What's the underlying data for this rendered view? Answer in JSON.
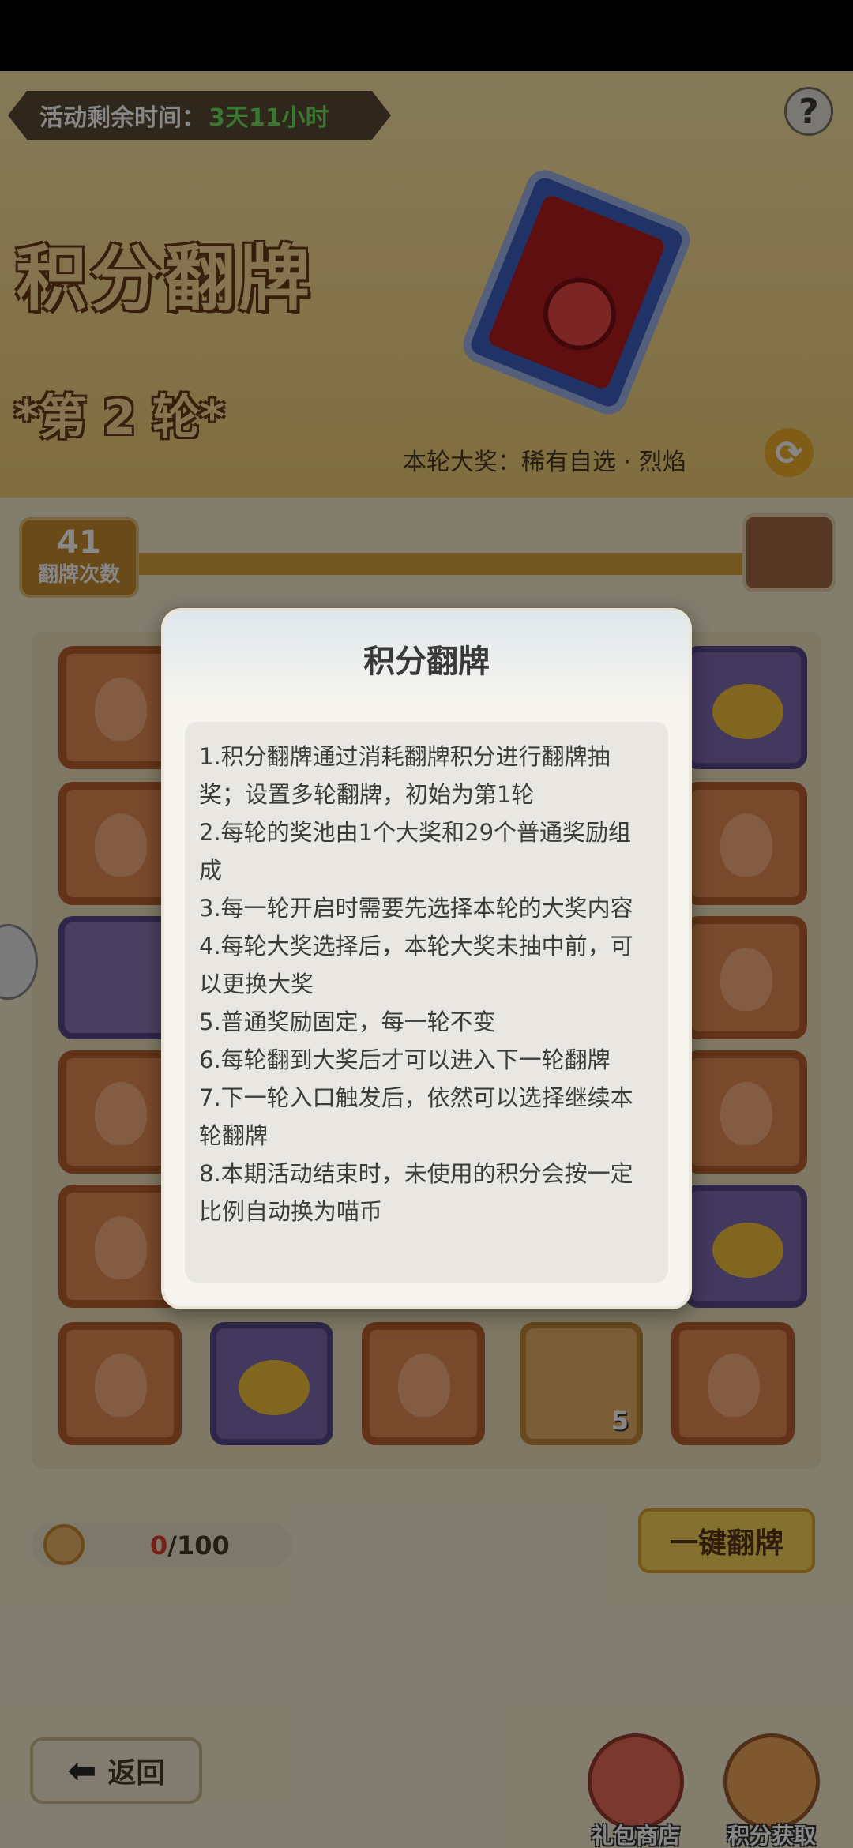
{
  "header": {
    "timer_label": "活动剩余时间：",
    "timer_value": "3天11小时",
    "help_icon": "?",
    "title": "积分翻牌",
    "round": "*第 2 轮*",
    "grand_prize": "本轮大奖：稀有自选 · 烈焰"
  },
  "progress": {
    "flip_count": "41",
    "flip_count_label": "翻牌次数"
  },
  "grid": {
    "item_count": "5"
  },
  "points": {
    "current": "0",
    "total": "/100"
  },
  "buttons": {
    "one_key": "一键翻牌",
    "back": "返回",
    "shop": "礼包商店",
    "earn": "积分获取"
  },
  "dialog": {
    "title": "积分翻牌",
    "rules": [
      "1.积分翻牌通过消耗翻牌积分进行翻牌抽奖；设置多轮翻牌，初始为第1轮",
      "2.每轮的奖池由1个大奖和29个普通奖励组成",
      "3.每一轮开启时需要先选择本轮的大奖内容",
      "4.每轮大奖选择后，本轮大奖未抽中前，可以更换大奖",
      "5.普通奖励固定，每一轮不变",
      "6.每轮翻到大奖后才可以进入下一轮翻牌",
      "7.下一轮入口触发后，依然可以选择继续本轮翻牌",
      "8.本期活动结束时，未使用的积分会按一定比例自动换为喵币"
    ]
  },
  "colors": {
    "accent_green": "#6fe05c",
    "points_red": "#e23b2e",
    "button_yellow": "#f9d55b"
  }
}
